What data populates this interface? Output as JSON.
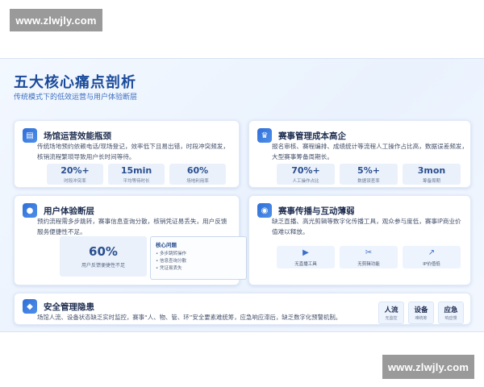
{
  "watermark": {
    "top": "www.zlwjly.com",
    "bottom": "www.zlwjly.com"
  },
  "slide": {
    "title": "五大核心痛点剖析",
    "subtitle": "传统模式下的低效运营与用户体验断层"
  },
  "cards": {
    "venue": {
      "icon": "building-icon",
      "title": "场馆运营效能瓶颈",
      "desc_lines": [
        "传统场地预约依赖电话/现场登记，效率低下且易出错，时段冲突频发，",
        "核销流程繁琐导致用户长时间等待。"
      ],
      "stats": [
        {
          "value": "20%+",
          "label": "时段冲突率"
        },
        {
          "value": "15min",
          "label": "平均等待时长"
        },
        {
          "value": "60%",
          "label": "场地利用率"
        }
      ]
    },
    "cost": {
      "icon": "trophy-icon",
      "title": "赛事管理成本高企",
      "desc_lines": [
        "报名审核、赛程编排、成绩统计等流程人工操作占比高，数据误差频发，",
        "大型赛事筹备周期长。"
      ],
      "stats": [
        {
          "value": "70%+",
          "label": "人工操作占比"
        },
        {
          "value": "5%+",
          "label": "数据误差率"
        },
        {
          "value": "3mon",
          "label": "筹备周期"
        }
      ]
    },
    "ux": {
      "icon": "user-icon",
      "title": "用户体验断层",
      "desc_lines": [
        "预约流程需多步跳转，赛事信息查询分散，核销凭证易丢失，用户反馈",
        "服务便捷性不足。"
      ],
      "big_value": "60%",
      "big_label": "用户反馈便捷性不足",
      "issues_title": "核心问题",
      "issues": [
        "多步跳转操作",
        "信息查询分散",
        "凭证易丢失"
      ]
    },
    "broadcast": {
      "icon": "broadcast-icon",
      "title": "赛事传播与互动薄弱",
      "desc_lines": [
        "缺乏直播、高光剪辑等数字化传播工具，观众参与度低，赛事IP商业价",
        "值难以释放。"
      ],
      "tools": [
        {
          "icon": "video-icon",
          "label": "无直播工具"
        },
        {
          "icon": "scissors-icon",
          "label": "无剪辑功能"
        },
        {
          "icon": "chart-icon",
          "label": "IP价值低"
        }
      ]
    },
    "security": {
      "icon": "shield-icon",
      "title": "安全管理隐患",
      "desc": "场馆人流、设备状态缺乏实时监控，赛事“人、物、管、环”安全要素难统筹，应急响应滞后，缺乏数字化预警机制。",
      "badges": [
        {
          "title": "人流",
          "sub": "无监控"
        },
        {
          "title": "设备",
          "sub": "难统筹"
        },
        {
          "title": "应急",
          "sub": "响应慢"
        }
      ]
    }
  },
  "colors": {
    "accent": "#2f6fd8",
    "title": "#1a4a9a",
    "background": "#eef4fd"
  }
}
